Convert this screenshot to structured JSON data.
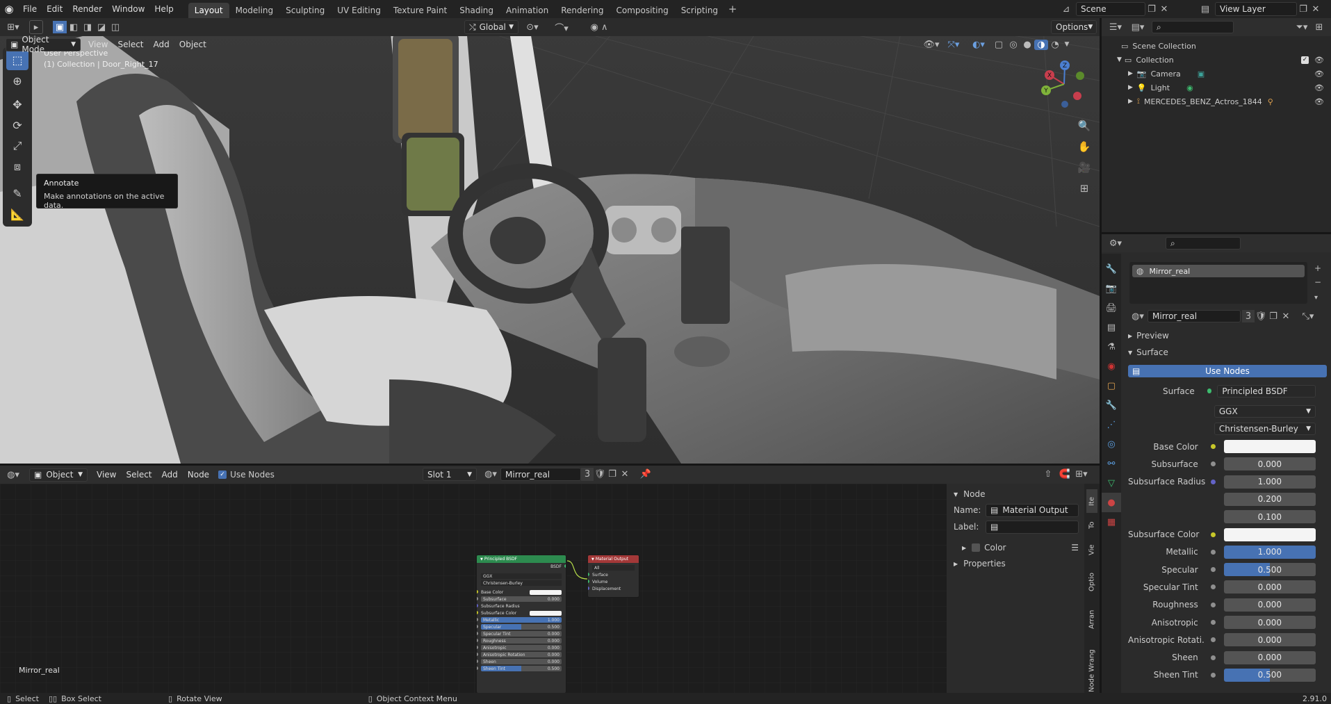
{
  "topbar": {
    "menus": [
      "File",
      "Edit",
      "Render",
      "Window",
      "Help"
    ],
    "workspaces": [
      "Layout",
      "Modeling",
      "Sculpting",
      "UV Editing",
      "Texture Paint",
      "Shading",
      "Animation",
      "Rendering",
      "Compositing",
      "Scripting"
    ],
    "active_workspace": "Layout",
    "add_tab": "+",
    "scene": "Scene",
    "view_layer": "View Layer"
  },
  "viewport": {
    "mode": "Object Mode",
    "menus": [
      "View",
      "Select",
      "Add",
      "Object"
    ],
    "transform_orientation": "Global",
    "options": "Options",
    "overlay_title": "User Perspective",
    "overlay_collection": "(1) Collection | Door_Right_17",
    "tooltip_title": "Annotate",
    "tooltip_desc": "Make annotations on the active data.",
    "gizmo": {
      "z": "Z",
      "y": "Y",
      "x": "X"
    }
  },
  "outliner": {
    "root": "Scene Collection",
    "collection": "Collection",
    "items": [
      "Camera",
      "Light",
      "MERCEDES_BENZ_Actros_1844"
    ]
  },
  "node_editor": {
    "editor_type": "Object",
    "menus": [
      "View",
      "Select",
      "Add",
      "Node"
    ],
    "use_nodes_label": "Use Nodes",
    "slot": "Slot 1",
    "material": "Mirror_real",
    "users": "3",
    "material_label": "Mirror_real",
    "side_panel": {
      "section": "Node",
      "name_label": "Name:",
      "name_value": "Material Output",
      "label_label": "Label:",
      "color_label": "Color",
      "properties_label": "Properties"
    },
    "side_tabs": [
      "Ite",
      "To",
      "Vie",
      "Optio",
      "Arran",
      "Node Wrang"
    ],
    "bsdf_node": {
      "title": "Principled BSDF",
      "output": "BSDF",
      "dist": "GGX",
      "sss": "Christensen-Burley",
      "rows": [
        {
          "label": "Base Color",
          "value": ""
        },
        {
          "label": "Subsurface",
          "value": "0.000"
        },
        {
          "label": "Subsurface Radius",
          "value": ""
        },
        {
          "label": "Subsurface Color",
          "value": ""
        },
        {
          "label": "Metallic",
          "value": "1.000"
        },
        {
          "label": "Specular",
          "value": "0.500"
        },
        {
          "label": "Specular Tint",
          "value": "0.000"
        },
        {
          "label": "Roughness",
          "value": "0.000"
        },
        {
          "label": "Anisotropic",
          "value": "0.000"
        },
        {
          "label": "Anisotropic Rotation",
          "value": "0.000"
        },
        {
          "label": "Sheen",
          "value": "0.000"
        },
        {
          "label": "Sheen Tint",
          "value": "0.500"
        }
      ]
    },
    "output_node": {
      "title": "Material Output",
      "target": "All",
      "inputs": [
        "Surface",
        "Volume",
        "Displacement"
      ]
    }
  },
  "properties": {
    "material_slot": "Mirror_real",
    "material_name": "Mirror_real",
    "users": "3",
    "preview": "Preview",
    "surface_section": "Surface",
    "use_nodes": "Use Nodes",
    "surface_label": "Surface",
    "surface_value": "Principled BSDF",
    "distribution": "GGX",
    "subsurface_method": "Christensen-Burley",
    "rows": [
      {
        "label": "Base Color",
        "value": "",
        "kind": "color",
        "dot": "yellow"
      },
      {
        "label": "Subsurface",
        "value": "0.000",
        "kind": "num",
        "dot": "gray"
      },
      {
        "label": "Subsurface Radius",
        "value": "1.000",
        "kind": "num",
        "dot": "purple"
      },
      {
        "label": "",
        "value": "0.200",
        "kind": "num",
        "dot": "none"
      },
      {
        "label": "",
        "value": "0.100",
        "kind": "num",
        "dot": "none"
      },
      {
        "label": "Subsurface Color",
        "value": "",
        "kind": "color",
        "dot": "yellow"
      },
      {
        "label": "Metallic",
        "value": "1.000",
        "kind": "full",
        "dot": "gray"
      },
      {
        "label": "Specular",
        "value": "0.500",
        "kind": "half",
        "dot": "gray"
      },
      {
        "label": "Specular Tint",
        "value": "0.000",
        "kind": "num",
        "dot": "gray"
      },
      {
        "label": "Roughness",
        "value": "0.000",
        "kind": "num",
        "dot": "gray"
      },
      {
        "label": "Anisotropic",
        "value": "0.000",
        "kind": "num",
        "dot": "gray"
      },
      {
        "label": "Anisotropic Rotati...",
        "value": "0.000",
        "kind": "num",
        "dot": "gray"
      },
      {
        "label": "Sheen",
        "value": "0.000",
        "kind": "num",
        "dot": "gray"
      },
      {
        "label": "Sheen Tint",
        "value": "0.500",
        "kind": "half",
        "dot": "gray"
      }
    ]
  },
  "statusbar": {
    "select": "Select",
    "box_select": "Box Select",
    "rotate_view": "Rotate View",
    "context_menu": "Object Context Menu",
    "version": "2.91.0"
  },
  "colors": {
    "accent": "#4772b3",
    "active_tab": "#3d3d3d",
    "bsdf_header": "#2d8b4f",
    "output_header": "#a33838"
  }
}
